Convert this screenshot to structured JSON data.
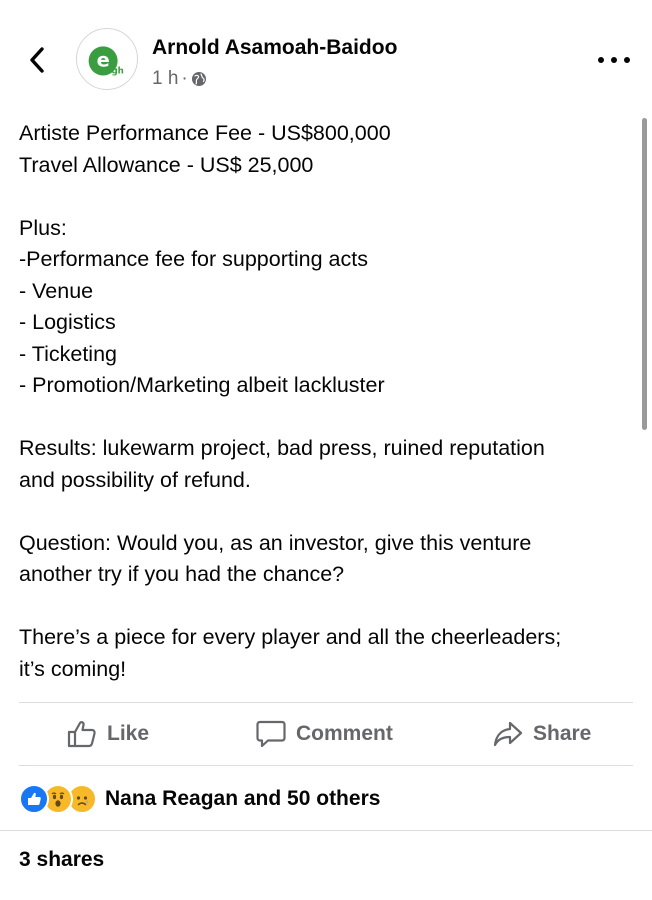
{
  "header": {
    "back_icon": "chevron-left-icon",
    "author_name": "Arnold Asamoah-Baidoo",
    "time": "1 h",
    "separator": "·",
    "privacy_icon": "globe-icon",
    "more_icon": "more-horizontal-icon",
    "avatar_letter": "e",
    "avatar_sub": "gh",
    "avatar_color": "#3a9d3f"
  },
  "post": {
    "lines": [
      "Artiste Performance Fee - US$800,000",
      "Travel Allowance - US$ 25,000",
      "",
      "Plus:",
      "-Performance fee for supporting acts",
      "- Venue",
      "- Logistics",
      "- Ticketing",
      "- Promotion/Marketing albeit lackluster",
      "",
      "Results: lukewarm project, bad press, ruined reputation",
      "and possibility of refund.",
      "",
      "Question: Would you, as an investor, give this venture",
      "another try if you had the chance?",
      "",
      "There’s a piece for every player and all the cheerleaders;",
      "it’s coming!"
    ]
  },
  "actions": {
    "like_label": "Like",
    "comment_label": "Comment",
    "share_label": "Share",
    "like_icon": "thumbs-up-icon",
    "comment_icon": "comment-icon",
    "share_icon": "share-arrow-icon"
  },
  "reactions": {
    "icons": [
      "like-reaction-icon",
      "wow-reaction-icon",
      "sad-reaction-icon"
    ],
    "summary": "Nana Reagan and 50 others"
  },
  "shares": {
    "label": "3 shares"
  },
  "colors": {
    "text": "#050505",
    "secondary": "#65676b",
    "like_blue": "#1877f2",
    "emoji_yellow": "#f7b928",
    "divider": "#dadde1"
  }
}
